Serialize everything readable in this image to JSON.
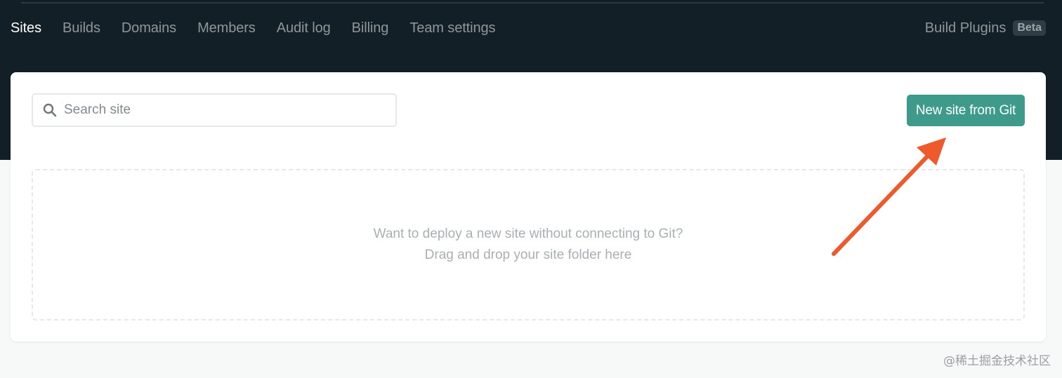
{
  "nav": {
    "items": [
      {
        "label": "Sites",
        "active": true
      },
      {
        "label": "Builds",
        "active": false
      },
      {
        "label": "Domains",
        "active": false
      },
      {
        "label": "Members",
        "active": false
      },
      {
        "label": "Audit log",
        "active": false
      },
      {
        "label": "Billing",
        "active": false
      },
      {
        "label": "Team settings",
        "active": false
      }
    ],
    "build_plugins_label": "Build Plugins",
    "beta_badge": "Beta"
  },
  "search": {
    "placeholder": "Search site",
    "value": "",
    "icon": "search-icon"
  },
  "actions": {
    "new_site_label": "New site from Git"
  },
  "dropzone": {
    "line1": "Want to deploy a new site without connecting to Git?",
    "line2": "Drag and drop your site folder here"
  },
  "watermark": "@稀土掘金技术社区",
  "colors": {
    "header_bg": "#131f26",
    "accent": "#3e9b8c",
    "annotation_arrow": "#ee5a2c"
  }
}
